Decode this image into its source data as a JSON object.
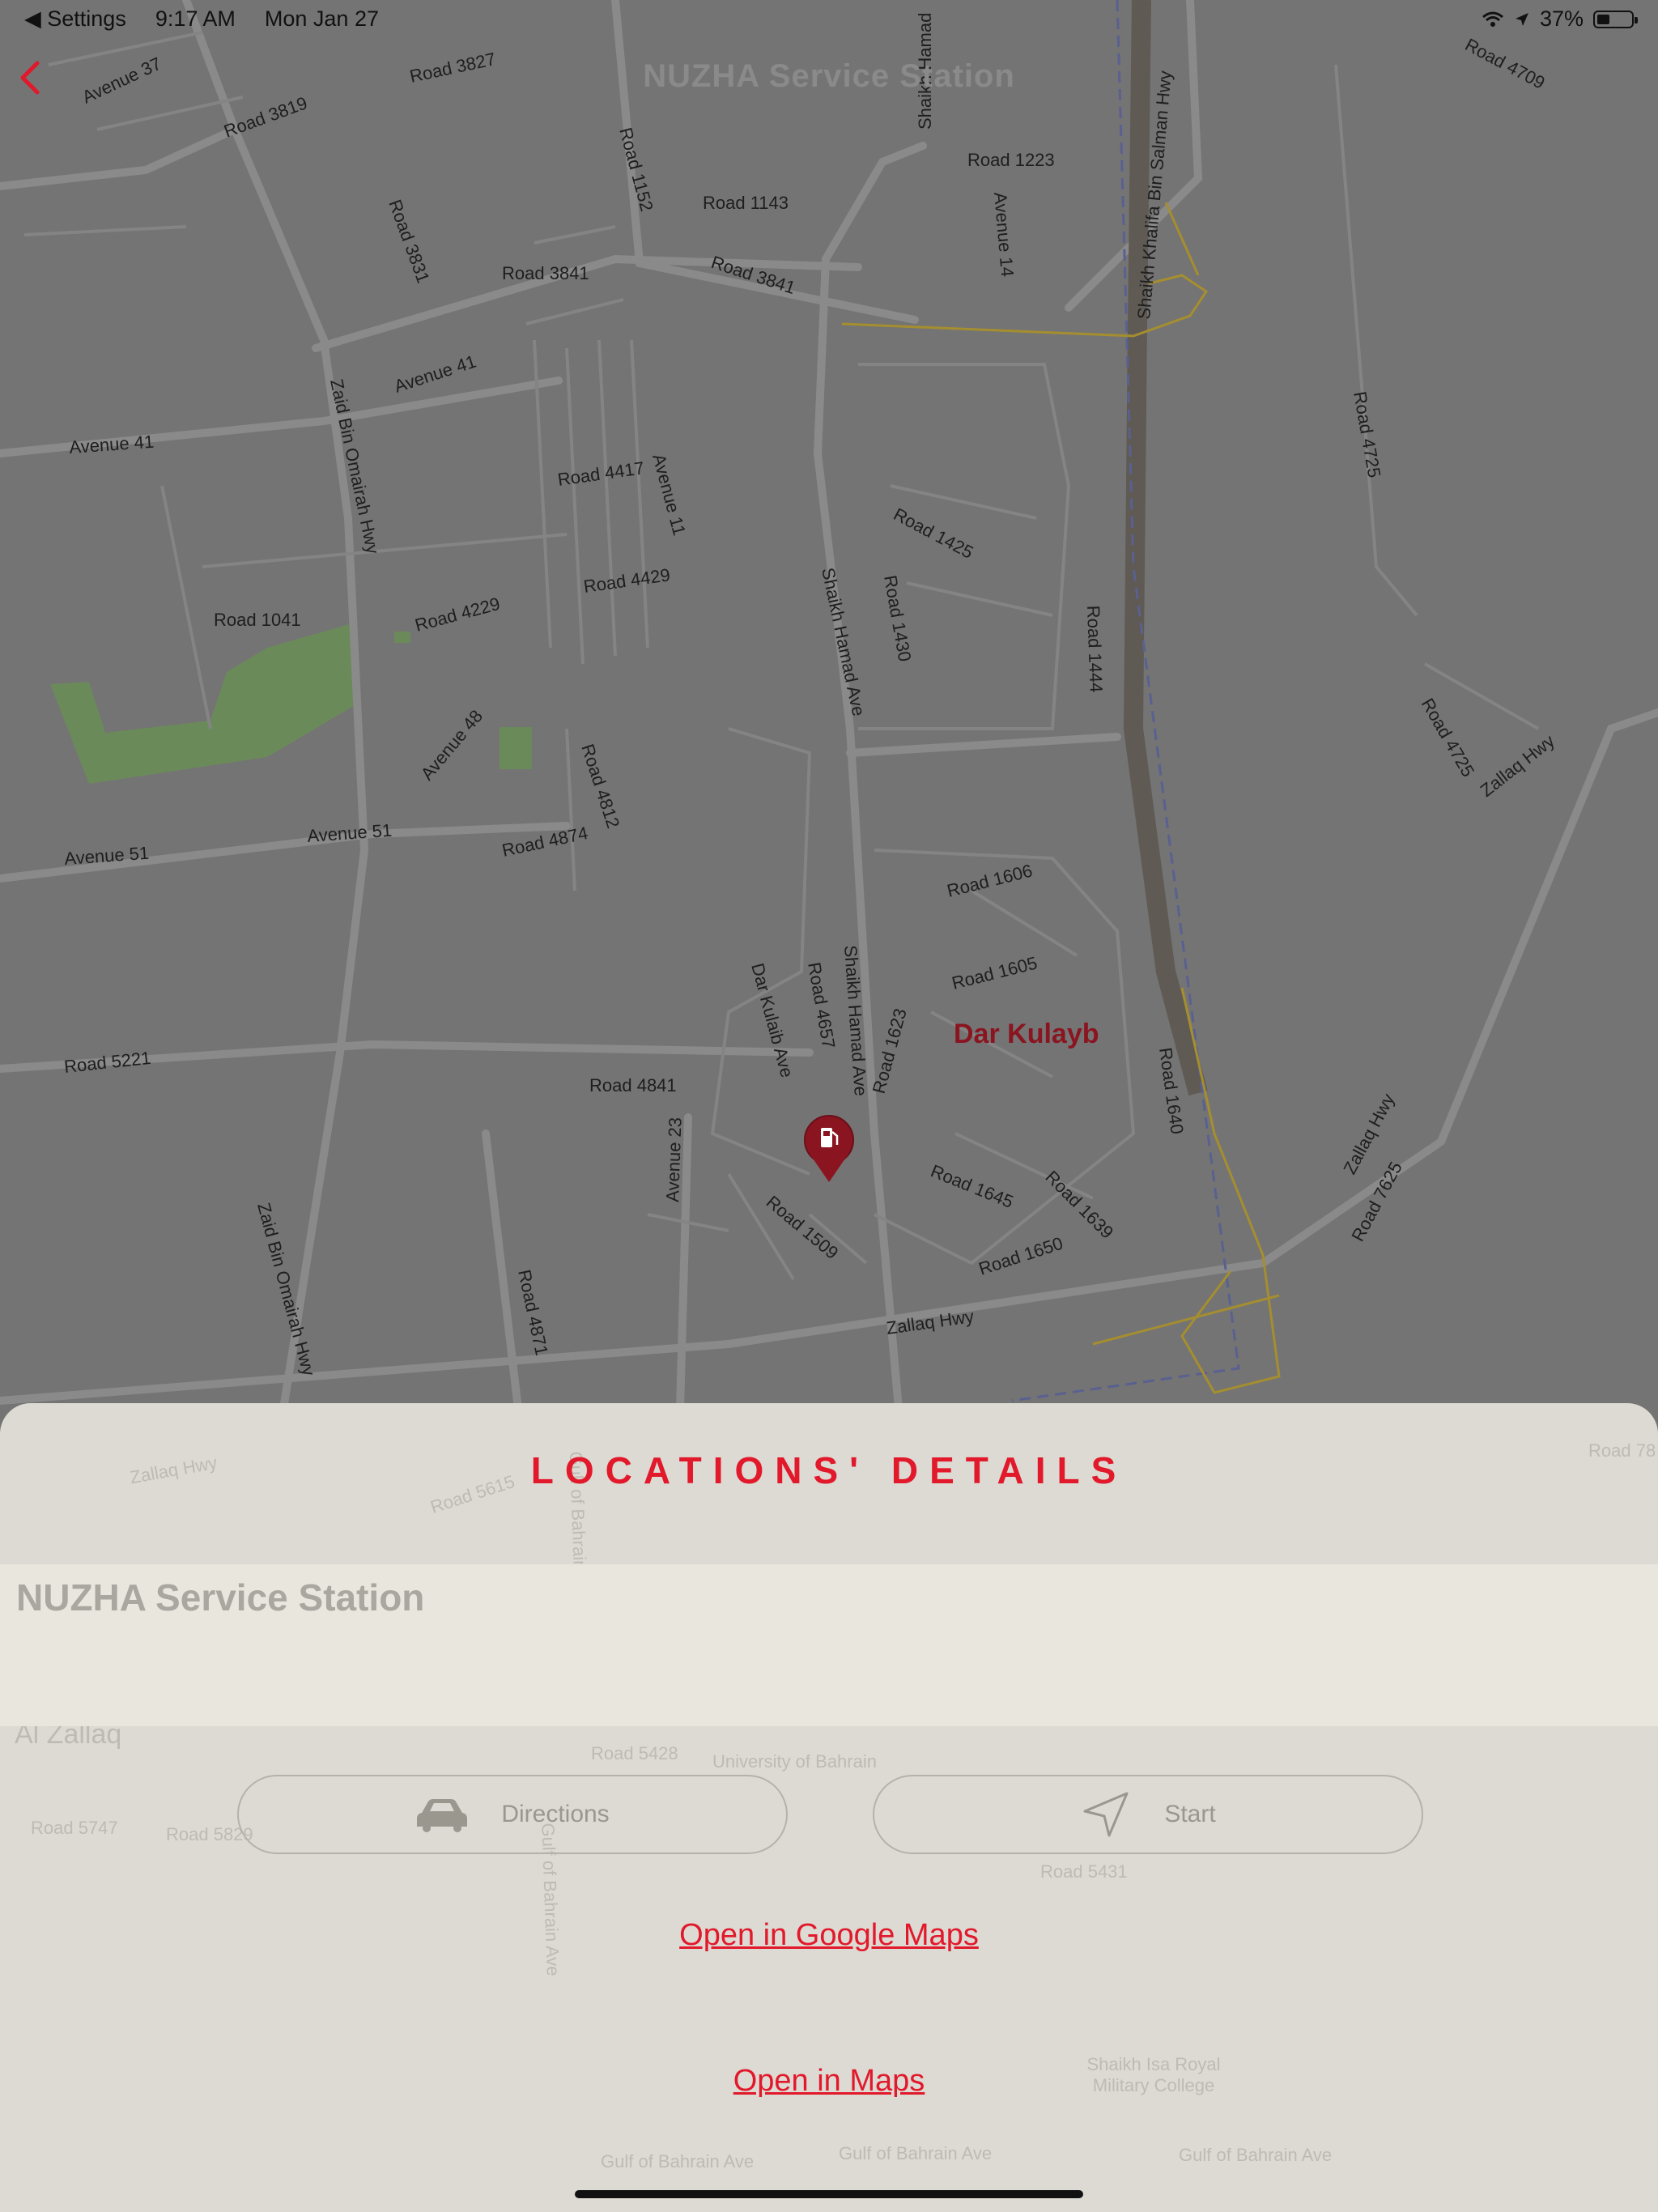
{
  "status_bar": {
    "back_app": "◀ Settings",
    "time": "9:17 AM",
    "date": "Mon Jan 27",
    "battery": "37%",
    "battery_level": 0.37
  },
  "nav": {
    "title": "NUZHA Service Station"
  },
  "map": {
    "place_label": "Dar Kulayb",
    "streets": [
      "Road 3827",
      "Avenue 37",
      "Road 3819",
      "Road 3831",
      "Road 3841",
      "Road 3841",
      "Road 1152",
      "Road 1143",
      "Road 1223",
      "Avenue 14",
      "Shaikh Hamad",
      "Shaikh Khalifa Bin Salman Hwy",
      "Road 4709",
      "Avenue 41",
      "Avenue 41",
      "Zaid Bin Omairah Hwy",
      "Road 4417",
      "Avenue 11",
      "Road 1425",
      "Road 1430",
      "Road 4429",
      "Road 1041",
      "Road 4229",
      "Shaikh Hamad Ave",
      "Road 1444",
      "Road 4725",
      "Road 4725",
      "Zallaq Hwy",
      "Avenue 48",
      "Road 4812",
      "Avenue 51",
      "Avenue 51",
      "Road 4874",
      "Road 1606",
      "Road 1605",
      "Road 4657",
      "Dar Kulaib Ave",
      "Shaikh Hamad Ave",
      "Road 1623",
      "Road 1640",
      "Road 5221",
      "Road 4841",
      "Avenue 23",
      "Road 1645",
      "Road 1639",
      "Road 1509",
      "Road 1650",
      "Zallaq Hwy",
      "Zallaq Hwy",
      "Road 7625",
      "Zaid Bin Omairah Hwy",
      "Road 4871"
    ],
    "pin_icon": "fuel-pin-icon",
    "park_color": "#6b8a5a"
  },
  "sheet": {
    "title": "LOCATIONS' DETAILS",
    "station_name": "NUZHA Service Station",
    "directions_label": "Directions",
    "start_label": "Start",
    "google_maps_link": "Open in Google Maps",
    "maps_link": "Open in Maps",
    "ghost_labels": [
      "Zallaq Hwy",
      "Road 5615",
      "Gulf of Bahrain",
      "Al Zallaq",
      "Road 5428",
      "University of Bahrain",
      "Road 5747",
      "Road 5829",
      "Gulf of Bahrain Ave",
      "Road 5431",
      "Shaikh Isa Royal Military College",
      "Gulf of Bahrain Ave",
      "Gulf of Bahrain Ave",
      "Gulf of Bahrain Ave",
      "Road 78"
    ]
  },
  "colors": {
    "accent": "#e2182b",
    "overlay_map": "#747474",
    "sheet_bg": "#dcdad3"
  }
}
